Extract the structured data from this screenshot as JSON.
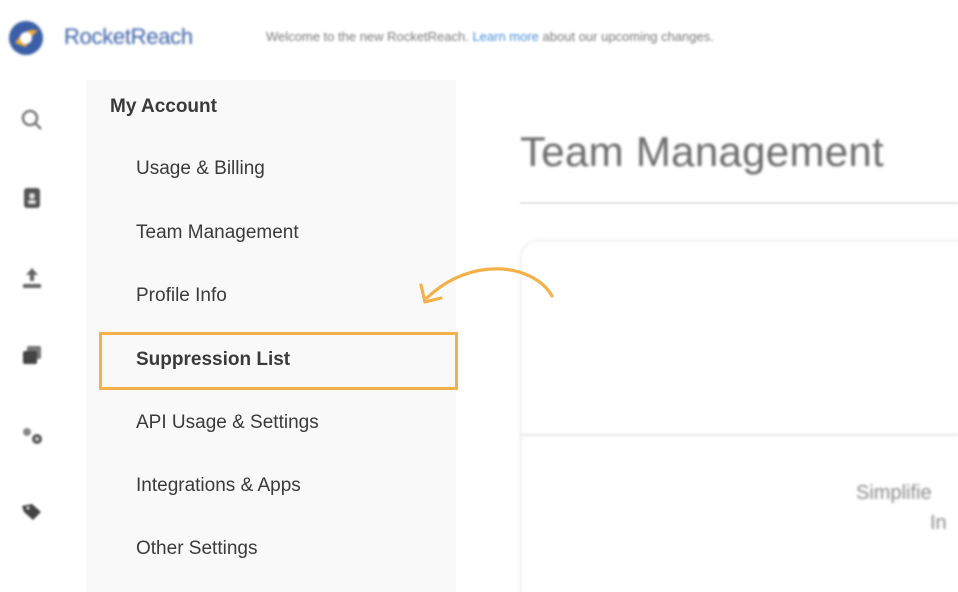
{
  "header": {
    "brand": "RocketReach",
    "welcome_prefix": "Welcome to the new RocketReach.",
    "learn_more": "Learn more",
    "welcome_suffix": "about our upcoming changes."
  },
  "rail": {
    "icons": [
      "search-icon",
      "contacts-icon",
      "upload-icon",
      "lists-icon",
      "settings-gears-icon",
      "tag-icon"
    ]
  },
  "sidebar": {
    "heading": "My Account",
    "items": [
      {
        "label": "Usage & Billing"
      },
      {
        "label": "Team Management"
      },
      {
        "label": "Profile Info"
      },
      {
        "label": "Suppression List",
        "active": true
      },
      {
        "label": "API Usage & Settings"
      },
      {
        "label": "Integrations & Apps"
      },
      {
        "label": "Other Settings"
      }
    ]
  },
  "main": {
    "title": "Team Management",
    "card_text_line1": "Simplifie",
    "card_text_line2": "In"
  },
  "colors": {
    "brand_blue": "#3a5fa6",
    "highlight": "#f3b04b",
    "link": "#4a90d9"
  }
}
